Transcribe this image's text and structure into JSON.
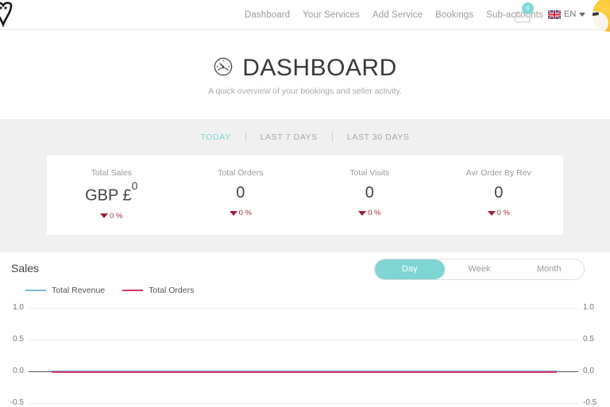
{
  "header": {
    "logo_icon": "heart-owl-logo",
    "nav": [
      {
        "label": "Dashboard"
      },
      {
        "label": "Your Services"
      },
      {
        "label": "Add Service"
      },
      {
        "label": "Bookings"
      },
      {
        "label": "Sub-accounts"
      }
    ],
    "messages": {
      "icon": "envelope-icon",
      "badge_count": "0",
      "badge_color": "#7fd8d4"
    },
    "language": {
      "flag_icon": "uk-flag-icon",
      "code": "EN",
      "caret_icon": "chevron-down-icon"
    },
    "avatar_icon": "user-avatar"
  },
  "page": {
    "icon": "speedometer-icon",
    "title": "DASHBOARD",
    "subtitle": "A quick overview of your bookings and seller activity."
  },
  "period_tabs": {
    "items": [
      {
        "label": "TODAY",
        "active": true
      },
      {
        "label": "LAST 7 DAYS",
        "active": false
      },
      {
        "label": "LAST 30 DAYS",
        "active": false
      }
    ],
    "active_color": "#7fd4d4"
  },
  "stats": [
    {
      "label": "Total Sales",
      "value": "GBP £",
      "value_sup": "0",
      "delta": "0 %",
      "delta_direction": "down",
      "delta_color": "#9e1f3a"
    },
    {
      "label": "Total Orders",
      "value": "0",
      "value_sup": "",
      "delta": "0 %",
      "delta_direction": "down",
      "delta_color": "#9e1f3a"
    },
    {
      "label": "Total Visits",
      "value": "0",
      "value_sup": "",
      "delta": "0 %",
      "delta_direction": "down",
      "delta_color": "#9e1f3a"
    },
    {
      "label": "Avr Order By Rev",
      "value": "0",
      "value_sup": "",
      "delta": "0 %",
      "delta_direction": "down",
      "delta_color": "#9e1f3a"
    }
  ],
  "sales": {
    "title": "Sales",
    "granularity": {
      "options": [
        {
          "label": "Day",
          "active": true
        },
        {
          "label": "Week",
          "active": false
        },
        {
          "label": "Month",
          "active": false
        }
      ],
      "active_color": "#7fd4d4"
    }
  },
  "chart_data": {
    "type": "line",
    "title": "Sales",
    "xlabel": "",
    "ylabel": "",
    "ylim": [
      -0.5,
      1.0
    ],
    "y_ticks": [
      "1.0",
      "0.5",
      "0.0",
      "-0.5"
    ],
    "right_y_ticks": [
      "1.0",
      "0.5",
      "0.0",
      "-0.5"
    ],
    "grid": true,
    "legend_position": "top-left",
    "x": [
      0,
      1
    ],
    "series": [
      {
        "name": "Total Revenue",
        "color": "#7ab8d9",
        "values": [
          0,
          0
        ]
      },
      {
        "name": "Total Orders",
        "color": "#d6336c",
        "values": [
          0,
          0
        ]
      }
    ]
  }
}
